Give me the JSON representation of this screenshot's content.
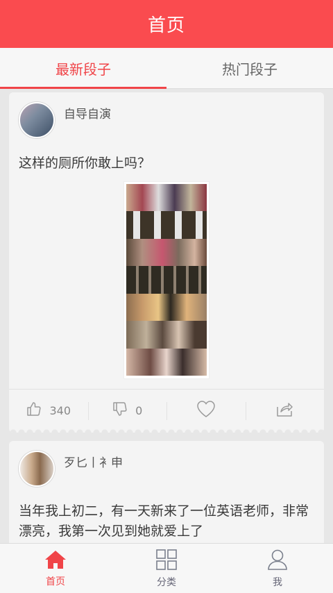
{
  "header": {
    "title": "首页"
  },
  "tabs": [
    {
      "label": "最新段子",
      "active": true
    },
    {
      "label": "热门段子",
      "active": false
    }
  ],
  "posts": [
    {
      "username": "自导自演",
      "text": "这样的厕所你敢上吗？",
      "likes": "340",
      "dislikes": "0"
    },
    {
      "username": "歹匕丨衤申",
      "text": "当年我上初二，有一天新来了一位英语老师，非常漂亮，我第一次见到她就爱上了"
    }
  ],
  "bottom_nav": [
    {
      "label": "首页",
      "icon": "home-icon",
      "active": true
    },
    {
      "label": "分类",
      "icon": "grid-icon",
      "active": false
    },
    {
      "label": "我",
      "icon": "person-icon",
      "active": false
    }
  ],
  "colors": {
    "accent": "#fa4b4f",
    "active_text": "#f04448",
    "background": "#e7e7e7"
  }
}
